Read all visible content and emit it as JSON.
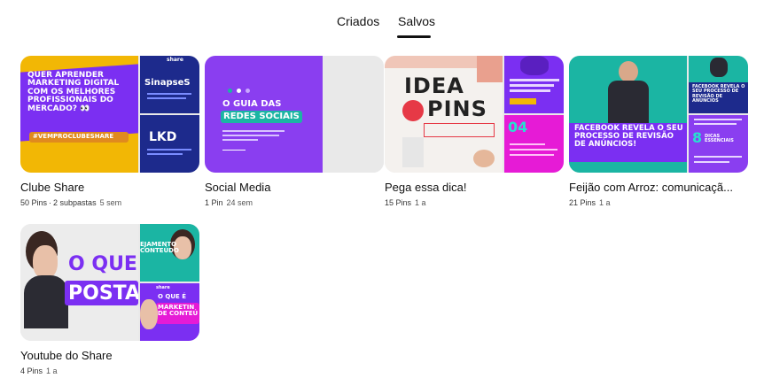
{
  "tabs": {
    "criados": "Criados",
    "salvos": "Salvos",
    "active": "salvos"
  },
  "boards": [
    {
      "title": "Clube Share",
      "pins": "50 Pins",
      "subfolders": "2 subpastas",
      "age": "5 sem",
      "art": {
        "main_text": "QUER APRENDER MARKETING DIGITAL COM OS MELHORES PROFISSIONAIS DO MERCADO? 👀",
        "main_tag": "#VEMPROCLUBESHARE",
        "top_text": "SinapseS",
        "bot_text": "LKD",
        "brand": "share"
      }
    },
    {
      "title": "Social Media",
      "pins": "1 Pin",
      "age": "24 sem",
      "art": {
        "main_text_1": "O GUIA DAS",
        "main_text_2": "REDES SOCIAIS"
      }
    },
    {
      "title": "Pega essa dica!",
      "pins": "15 Pins",
      "age": "1 a",
      "art": {
        "main_text_1": "IDEA",
        "main_text_2": "PINS",
        "bot_text": "04"
      }
    },
    {
      "title": "Feijão com Arroz: comunicaçã...",
      "pins": "21 Pins",
      "age": "1 a",
      "art": {
        "main_text": "FACEBOOK REVELA O SEU PROCESSO DE REVISÃO DE ANÚNCIOS!",
        "top_text": "FACEBOOK REVELA O SEU PROCESSO DE REVISÃO DE ANÚNCIOS",
        "bot_num": "8",
        "bot_text": "DICAS ESSENCIAIS"
      }
    },
    {
      "title": "Youtube do Share",
      "pins": "4 Pins",
      "age": "1 a",
      "art": {
        "main_text_1": "O QUE",
        "main_text_2": "POSTA",
        "top_text": "EJAMENTO CONTEÚDO",
        "bot_text_1": "O QUE É",
        "bot_text_2": "MARKETIN DE CONTEÚ",
        "brand": "share"
      }
    }
  ],
  "colors": {
    "purple": "#7b2ff2",
    "violet": "#8a3ef0",
    "yellow": "#f2b705",
    "navy": "#1d2a8c",
    "teal": "#1bb5a3",
    "magenta": "#e61bd6"
  }
}
